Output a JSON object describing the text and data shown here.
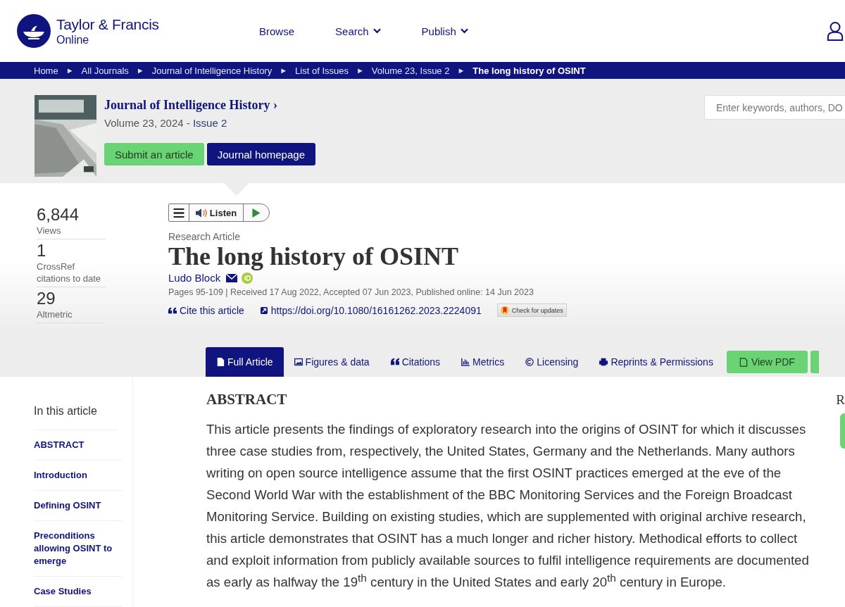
{
  "header": {
    "brand": "Taylor & Francis",
    "brand_sub": "Online",
    "nav": [
      {
        "label": "Browse",
        "dropdown": false
      },
      {
        "label": "Search",
        "dropdown": true
      },
      {
        "label": "Publish",
        "dropdown": true
      }
    ]
  },
  "breadcrumb": [
    {
      "label": "Home",
      "current": false
    },
    {
      "label": "All Journals",
      "current": false
    },
    {
      "label": "Journal of Intelligence History",
      "current": false
    },
    {
      "label": "List of Issues",
      "current": false
    },
    {
      "label": "Volume 23, Issue 2",
      "current": false
    },
    {
      "label": "The long history of OSINT",
      "current": true
    }
  ],
  "separator": "►",
  "journal": {
    "title": "Journal of Intelligence History",
    "chevron": "›",
    "volume": "Volume 23, 2024 - ",
    "issue": "Issue 2",
    "buttons": [
      {
        "label": "Submit an article",
        "kind": "green"
      },
      {
        "label": "Journal homepage",
        "kind": "navy"
      }
    ]
  },
  "search": {
    "placeholder": "Enter keywords, authors, DO"
  },
  "metrics": [
    {
      "value": "6,844",
      "label": "Views"
    },
    {
      "value": "1",
      "label": "CrossRef citations to date"
    },
    {
      "value": "29",
      "label": "Altmetric"
    }
  ],
  "listen": {
    "label": "Listen"
  },
  "article": {
    "type": "Research Article",
    "title": "The long history of OSINT",
    "author": "Ludo Block",
    "meta": "Pages 95-109 | Received 17 Aug 2022, Accepted 07 Jun 2023, Published online: 14 Jun 2023",
    "cite": "Cite this article",
    "doi": "https://doi.org/10.1080/16161262.2023.2224091",
    "updates": "Check for updates"
  },
  "tabs": [
    {
      "label": "Full Article",
      "selected": true
    },
    {
      "label": "Figures & data",
      "selected": false
    },
    {
      "label": "Citations",
      "selected": false
    },
    {
      "label": "Metrics",
      "selected": false
    },
    {
      "label": "Licensing",
      "selected": false
    },
    {
      "label": "Reprints & Permissions",
      "selected": false
    }
  ],
  "pdf_button": {
    "label": "View PDF"
  },
  "toc": {
    "title": "In this article",
    "items": [
      {
        "label": "ABSTRACT"
      },
      {
        "label": "Introduction"
      },
      {
        "label": "Defining OSINT"
      },
      {
        "label": "Preconditions allowing OSINT to emerge"
      },
      {
        "label": "Case Studies"
      }
    ]
  },
  "abstract": {
    "heading": "ABSTRACT",
    "text": "This article presents the findings of exploratory research into the origins of OSINT for which it discusses three case studies from, respectively, the United States, Germany and the Netherlands. Many authors writing on open source intelligence assume that the first OSINT practices emerged at the eve of the Second World War with the establishment of the BBC Monitoring Services and the Foreign Broadcast Monitoring Service. Building on existing studies, which are supplemented with original archive research, this article demonstrates that OSINT has a much longer and richer history. Methodical efforts to collect and exploit information from publicly available sources to fulfil intelligence requirements are documented as early as halfway the 19$^{th}$ century in the United States and early 20$^{th}$ century in Europe."
  },
  "side_heading": "R"
}
